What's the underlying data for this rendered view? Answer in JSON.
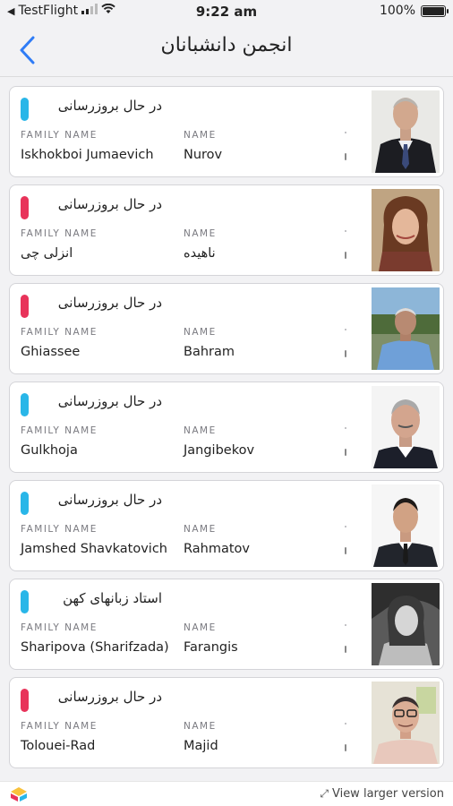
{
  "status_bar": {
    "carrier": "TestFlight",
    "time": "9:22 am",
    "battery": "100%"
  },
  "nav": {
    "title": "انجمن دانشبانان"
  },
  "labels": {
    "family": "FAMILY NAME",
    "name": "NAME"
  },
  "people": [
    {
      "status": "در حال بروزرسانی",
      "status_color": "#29b6e8",
      "family": "Iskhokboi Jumaevich",
      "name": "Nurov"
    },
    {
      "status": "در حال بروزرسانی",
      "status_color": "#e8335a",
      "family": "انزلی چی",
      "name": "ناهیده"
    },
    {
      "status": "در حال بروزرسانی",
      "status_color": "#e8335a",
      "family": "Ghiassee",
      "name": "Bahram"
    },
    {
      "status": "در حال بروزرسانی",
      "status_color": "#29b6e8",
      "family": "Gulkhoja",
      "name": "Jangibekov"
    },
    {
      "status": "در حال بروزرسانی",
      "status_color": "#29b6e8",
      "family": "Jamshed Shavkatovich",
      "name": "Rahmatov"
    },
    {
      "status": "استاد زبانهای کهن",
      "status_color": "#29b6e8",
      "family": "Sharipova (Sharifzada)",
      "name": "Farangis"
    },
    {
      "status": "در حال بروزرسانی",
      "status_color": "#e8335a",
      "family": "Tolouei-Rad",
      "name": "Majid"
    }
  ],
  "footer": {
    "link": "View larger version"
  },
  "colors": {
    "accent": "#2f7cf6"
  }
}
